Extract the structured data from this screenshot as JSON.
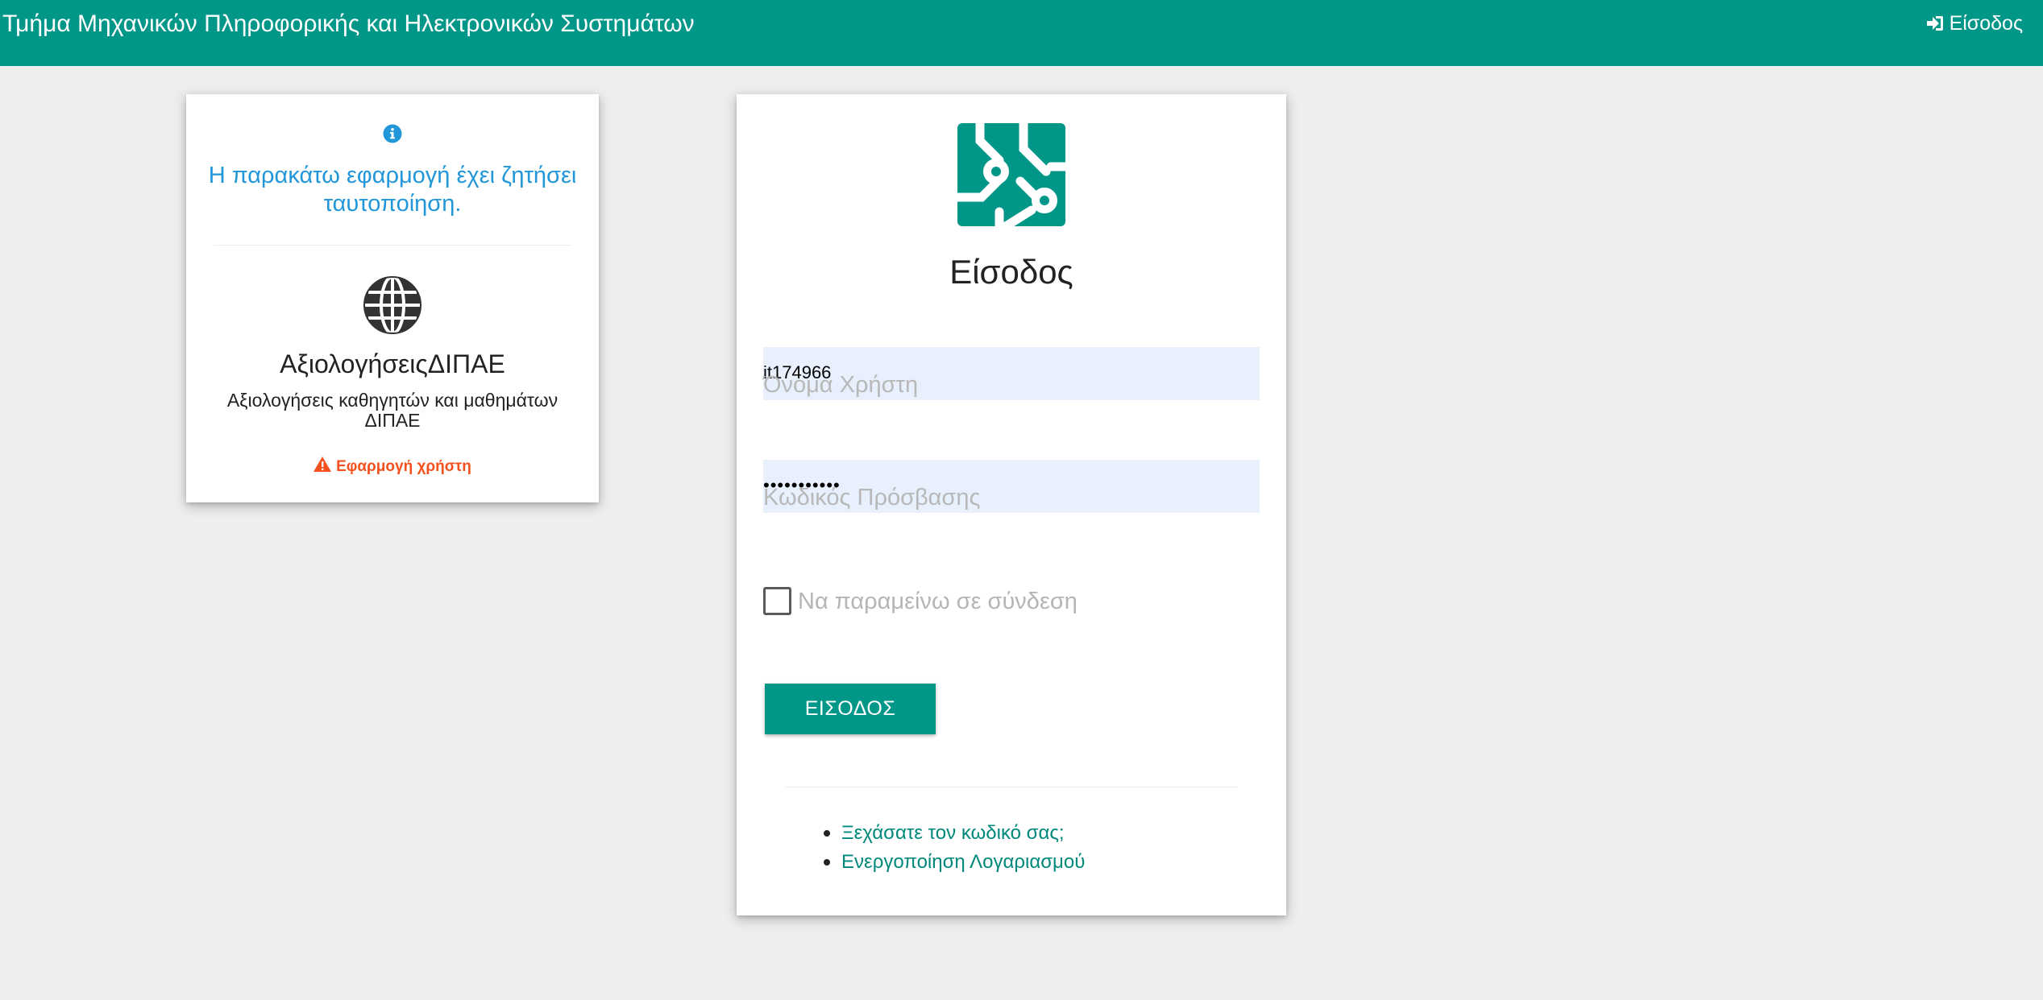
{
  "header": {
    "site_title": "Τμήμα Μηχανικών Πληροφορικής και Ηλεκτρονικών Συστημάτων",
    "login_label": "Είσοδος"
  },
  "info_card": {
    "request_text": "Η παρακάτω εφαρμογή έχει ζητήσει ταυτοποίηση.",
    "app_name": "ΑξιολογήσειςΔΙΠΑΕ",
    "app_description": "Αξιολογήσεις καθηγητών και μαθημάτων ΔΙΠΑΕ",
    "app_type": "Εφαρμογή χρήστη"
  },
  "login_form": {
    "title": "Είσοδος",
    "username": {
      "value": "it174966",
      "label": "Όνομα Χρήστη"
    },
    "password": {
      "value": "•••••••••••",
      "label": "Κωδικός Πρόσβασης"
    },
    "remember_label": "Να παραμείνω σε σύνδεση",
    "remember_checked": false,
    "submit_label": "ΕΙΣΟΔΟΣ",
    "links": [
      "Ξεχάσατε τον κωδικό σας;",
      "Ενεργοποίηση Λογαριασμού"
    ]
  },
  "colors": {
    "primary": "#009688",
    "info_blue": "#2196d9",
    "warning": "#f4511e",
    "link": "#00897b",
    "autofill": "#e8f0fe"
  }
}
